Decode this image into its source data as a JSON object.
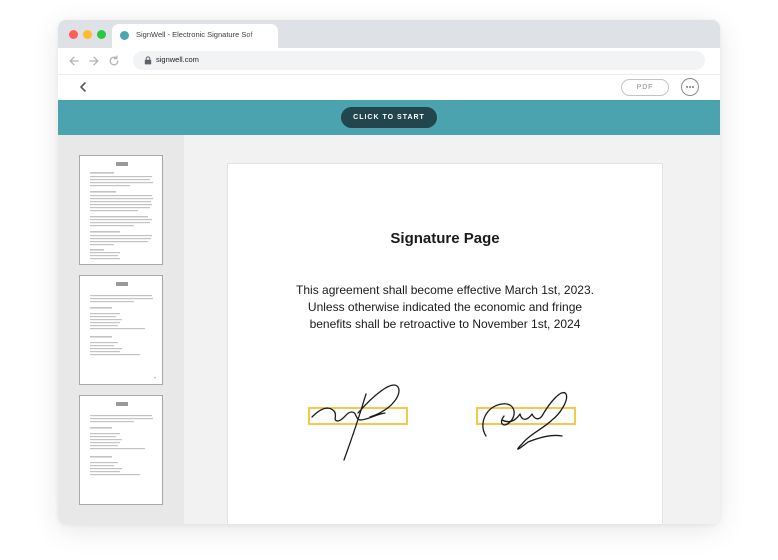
{
  "browser": {
    "tab_title": "SignWell - Electronic Signature Sof",
    "url": "signwell.com"
  },
  "header": {
    "pdf_label": "PDF"
  },
  "banner": {
    "start_label": "CLICK TO START"
  },
  "document": {
    "title": "Signature Page",
    "body_lines": [
      "This agreement shall become effective March 1st, 2023.",
      "Unless otherwise indicated the economic and fringe",
      "benefits shall be retroactive to November 1st, 2024"
    ]
  },
  "colors": {
    "banner": "#4ba3af",
    "start_button": "#22454e",
    "signature_field_border": "#f2c94c",
    "favicon": "#4ba6b0"
  },
  "icons": {
    "back": "chevron-left-icon",
    "more": "more-horizontal-icon",
    "lock": "lock-icon"
  }
}
